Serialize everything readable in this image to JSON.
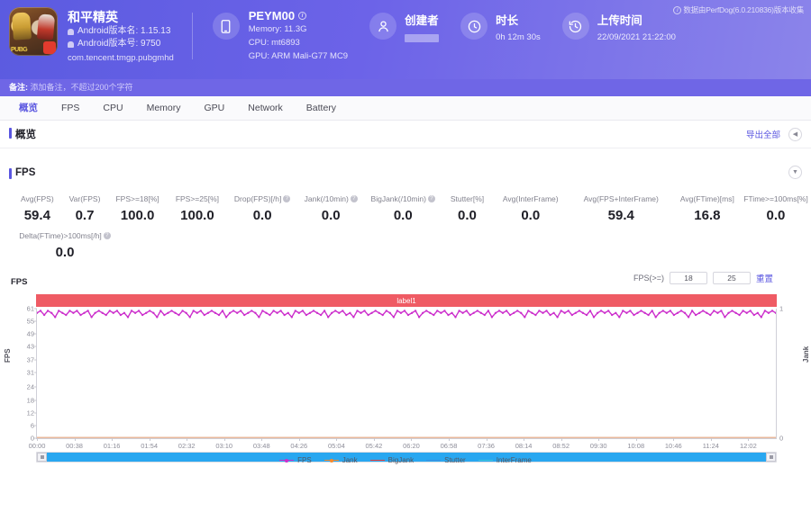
{
  "header": {
    "perfdog_note": "数据由PerfDog(6.0.210836)版本收集",
    "app": {
      "icon_tag": "PUBG",
      "title": "和平精英",
      "version_name": "Android版本名: 1.15.13",
      "version_code": "Android版本号: 9750",
      "package": "com.tencent.tmgp.pubgmhd"
    },
    "device": {
      "icon": "phone-icon",
      "model": "PEYM00",
      "memory": "Memory: 11.3G",
      "cpu": "CPU: mt6893",
      "gpu": "GPU: ARM Mali-G77 MC9"
    },
    "creator": {
      "icon": "user-icon",
      "label": "创建者",
      "value": ""
    },
    "duration": {
      "icon": "clock-icon",
      "label": "时长",
      "value": "0h 12m 30s"
    },
    "upload": {
      "icon": "history-icon",
      "label": "上传时间",
      "value": "22/09/2021 21:22:00"
    }
  },
  "remark": {
    "label": "备注:",
    "placeholder": "添加备注，不超过200个字符"
  },
  "tabs": [
    {
      "label": "概览",
      "active": true
    },
    {
      "label": "FPS",
      "active": false
    },
    {
      "label": "CPU",
      "active": false
    },
    {
      "label": "Memory",
      "active": false
    },
    {
      "label": "GPU",
      "active": false
    },
    {
      "label": "Network",
      "active": false
    },
    {
      "label": "Battery",
      "active": false
    }
  ],
  "overview": {
    "title": "概览",
    "export_label": "导出全部",
    "collapse_icon": "chevron-left-icon"
  },
  "fps_section": {
    "title": "FPS",
    "expand_icon": "chevron-down-icon",
    "stats_row1": [
      {
        "label": "Avg(FPS)",
        "value": "59.4",
        "help": false
      },
      {
        "label": "Var(FPS)",
        "value": "0.7",
        "help": false
      },
      {
        "label": "FPS>=18[%]",
        "value": "100.0",
        "help": false
      },
      {
        "label": "FPS>=25[%]",
        "value": "100.0",
        "help": false
      },
      {
        "label": "Drop(FPS)[/h]",
        "value": "0.0",
        "help": true
      },
      {
        "label": "Jank(/10min)",
        "value": "0.0",
        "help": true
      },
      {
        "label": "BigJank(/10min)",
        "value": "0.0",
        "help": true
      },
      {
        "label": "Stutter[%]",
        "value": "0.0",
        "help": false
      },
      {
        "label": "Avg(InterFrame)",
        "value": "0.0",
        "help": false
      },
      {
        "label": "Avg(FPS+InterFrame)",
        "value": "59.4",
        "help": false
      },
      {
        "label": "Avg(FTime)[ms]",
        "value": "16.8",
        "help": false
      },
      {
        "label": "FTime>=100ms[%]",
        "value": "0.0",
        "help": false
      }
    ],
    "stats_row2": [
      {
        "label": "Delta(FTime)>100ms[/h]",
        "value": "0.0",
        "help": true
      }
    ]
  },
  "chart_controls": {
    "chart_name": "FPS",
    "threshold_label": "FPS(>=)",
    "threshold_low": "18",
    "threshold_high": "25",
    "reset_label": "重置"
  },
  "label_bar": {
    "text": "label1",
    "color": "#ef5b64"
  },
  "scrollbar": {
    "left_handle": "drag-handle",
    "right_handle": "drag-handle"
  },
  "chart_data": {
    "type": "line",
    "title": "FPS",
    "xlabel": "",
    "ylabel": "FPS",
    "y2label": "Jank",
    "grid": false,
    "legend_position": "bottom",
    "ylim": [
      0,
      61
    ],
    "y2lim": [
      0,
      1
    ],
    "yticks": [
      0,
      6,
      12,
      18,
      24,
      31,
      37,
      43,
      49,
      55,
      61
    ],
    "y2ticks": [
      0,
      1
    ],
    "xticks": [
      "00:00",
      "00:38",
      "01:16",
      "01:54",
      "02:32",
      "03:10",
      "03:48",
      "04:26",
      "05:04",
      "05:42",
      "06:20",
      "06:58",
      "07:36",
      "08:14",
      "08:52",
      "09:30",
      "10:08",
      "10:46",
      "11:24",
      "12:02"
    ],
    "xlim": [
      "00:00",
      "12:30"
    ],
    "series": [
      {
        "name": "FPS",
        "color": "#cc2fcc",
        "axis": "left",
        "values": [
          59,
          60,
          58,
          60,
          59,
          57,
          60,
          59,
          58,
          60,
          59,
          60,
          58,
          59,
          60,
          57,
          59,
          60,
          59,
          58,
          60,
          59,
          60,
          58,
          59,
          57,
          60,
          59,
          60,
          58,
          59,
          60,
          59,
          57,
          60,
          58,
          59,
          60,
          59,
          58,
          60,
          59,
          57,
          60,
          59,
          60,
          58,
          59,
          60,
          59,
          58,
          60,
          57,
          59,
          60,
          59,
          60,
          58,
          59,
          60,
          59,
          57,
          60,
          59,
          58,
          60,
          59,
          60,
          58,
          59,
          57,
          60,
          59,
          60,
          58,
          59,
          60,
          59,
          58,
          60,
          57,
          59,
          60,
          59,
          60,
          58,
          59,
          57,
          60,
          59,
          60,
          58,
          59,
          60,
          59,
          58,
          60,
          59,
          57,
          60,
          59,
          60,
          58,
          59,
          60,
          57,
          59,
          60,
          59,
          58,
          60,
          59,
          60,
          58,
          59,
          57,
          60,
          59,
          60,
          58,
          59,
          60,
          59,
          58,
          60,
          57,
          59,
          60,
          59,
          60,
          58,
          59,
          60,
          59,
          57,
          60,
          59,
          58,
          60,
          59,
          60,
          58,
          59,
          57,
          60,
          59,
          60,
          58,
          59,
          60,
          59,
          58,
          60,
          57,
          59,
          60,
          59,
          60,
          58,
          59,
          57,
          60,
          59,
          60,
          58,
          59,
          60,
          59,
          58,
          60,
          57,
          59,
          60,
          59,
          60,
          58,
          59,
          60,
          59,
          57,
          60,
          58,
          59,
          60,
          59,
          58,
          60,
          59,
          60,
          57,
          59,
          60,
          59,
          58,
          60,
          59,
          60,
          58,
          59,
          57,
          60,
          59,
          60,
          59
        ]
      },
      {
        "name": "Jank",
        "color": "#f58a2e",
        "axis": "right",
        "values": []
      },
      {
        "name": "BigJank",
        "color": "#e8413c",
        "axis": "right",
        "values": []
      },
      {
        "name": "Stutter",
        "color": "#3c8fe0",
        "axis": "right",
        "values": []
      },
      {
        "name": "InterFrame",
        "color": "#3fc5d8",
        "axis": "left",
        "values": []
      }
    ],
    "legend": [
      {
        "name": "FPS",
        "color": "#cc2fcc",
        "marker": "line-dot"
      },
      {
        "name": "Jank",
        "color": "#f58a2e",
        "marker": "line-dot"
      },
      {
        "name": "BigJank",
        "color": "#e8413c",
        "marker": "line"
      },
      {
        "name": "Stutter",
        "color": "#3c8fe0",
        "marker": "line"
      },
      {
        "name": "InterFrame",
        "color": "#3fc5d8",
        "marker": "line"
      }
    ]
  }
}
